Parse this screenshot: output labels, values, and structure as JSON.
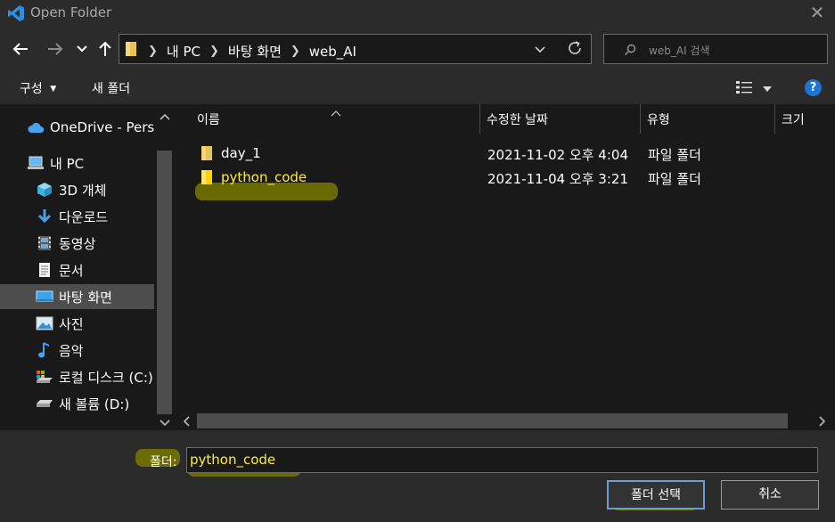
{
  "window": {
    "title": "Open Folder",
    "close_symbol": "✕"
  },
  "nav": {
    "back": "back-arrow",
    "forward": "forward-arrow",
    "recent": "chevron-down",
    "up": "up-arrow",
    "breadcrumbs": [
      "내 PC",
      "바탕 화면",
      "web_AI"
    ],
    "search_placeholder": "web_AI 검색"
  },
  "toolbar": {
    "organize": "구성",
    "new_folder": "새 폴더"
  },
  "sidebar": {
    "items": [
      {
        "label": "OneDrive - Personal",
        "icon": "cloud-icon"
      },
      {
        "label": "내 PC",
        "icon": "pc-icon"
      },
      {
        "label": "3D 개체",
        "icon": "cube-icon"
      },
      {
        "label": "다운로드",
        "icon": "download-icon"
      },
      {
        "label": "동영상",
        "icon": "video-icon"
      },
      {
        "label": "문서",
        "icon": "document-icon"
      },
      {
        "label": "바탕 화면",
        "icon": "desktop-icon",
        "selected": true
      },
      {
        "label": "사진",
        "icon": "picture-icon"
      },
      {
        "label": "음악",
        "icon": "music-icon"
      },
      {
        "label": "로컬 디스크 (C:)",
        "icon": "drive-icon"
      },
      {
        "label": "새 볼륨 (D:)",
        "icon": "drive-icon"
      }
    ]
  },
  "columns": [
    "이름",
    "수정한 날짜",
    "유형",
    "크기"
  ],
  "files": [
    {
      "name": "day_1",
      "date": "2021-11-02 오후 4:04",
      "type": "파일 폴더"
    },
    {
      "name": "python_code",
      "date": "2021-11-04 오후 3:21",
      "type": "파일 폴더"
    }
  ],
  "footer": {
    "folder_label": "폴더:",
    "folder_value": "python_code",
    "select_button": "폴더 선택",
    "cancel_button": "취소"
  },
  "colors": {
    "highlight": "#787800",
    "accent": "#0078d7",
    "selected_text": "#ffeb3b"
  }
}
